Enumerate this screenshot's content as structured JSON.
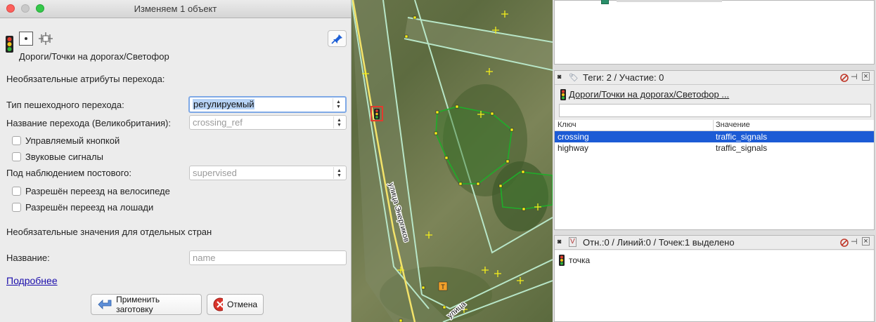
{
  "dialog": {
    "title": "Изменяем 1 объект",
    "preset_path": "Дороги/Точки на дорогах/Светофор",
    "section_optional": "Необязательные атрибуты перехода:",
    "crossing_type_label": "Тип пешеходного перехода:",
    "crossing_type_value": "регулируемый",
    "crossing_name_label": "Название перехода (Великобритания):",
    "crossing_name_placeholder": "crossing_ref",
    "button_operated_label": "Управляемый кнопкой",
    "sound_signals_label": "Звуковые сигналы",
    "supervised_label": "Под наблюдением постового:",
    "supervised_placeholder": "supervised",
    "bicycle_label": "Разрешён переезд на велосипеде",
    "horse_label": "Разрешён переезд на лошади",
    "section_country": "Необязательные значения для отдельных стран",
    "name_label": "Название:",
    "name_placeholder": "name",
    "more_link": "Подробнее",
    "apply_button": "Применить заготовку",
    "cancel_button": "Отмена"
  },
  "tags_panel": {
    "header": "Теги: 2 / Участие: 0",
    "preset_link": "Дороги/Точки на дорогах/Светофор ...",
    "col_key": "Ключ",
    "col_value": "Значение",
    "rows": [
      {
        "key": "crossing",
        "value": "traffic_signals",
        "selected": true
      },
      {
        "key": "highway",
        "value": "traffic_signals",
        "selected": false
      }
    ]
  },
  "selection_panel": {
    "header": "Отн.:0 / Линий:0 / Точек:1 выделено",
    "items": [
      "точка"
    ]
  },
  "map": {
    "street_label_1": "улица Энергиков",
    "street_label_2": "улица"
  },
  "colors": {
    "selection_blue": "#1c5bd5",
    "link_blue": "#1a0dab",
    "traffic_red": "#e23b2e",
    "traffic_yellow": "#f2c418",
    "traffic_green": "#2fb33a"
  }
}
